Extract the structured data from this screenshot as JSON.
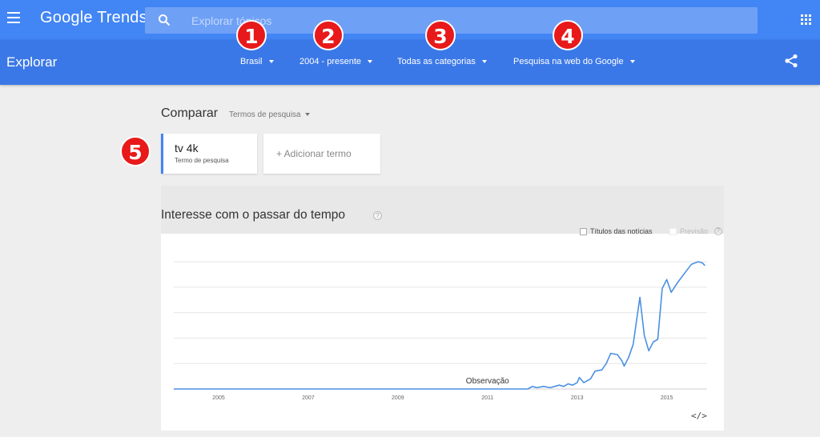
{
  "app": {
    "logo_text": "Google Trends"
  },
  "search": {
    "placeholder": "Explorar tópicos"
  },
  "header": {
    "page_title": "Explorar"
  },
  "filters": [
    {
      "label": "Brasil"
    },
    {
      "label": "2004 - presente"
    },
    {
      "label": "Todas as categorias"
    },
    {
      "label": "Pesquisa na web do Google"
    }
  ],
  "badges": [
    "1",
    "2",
    "3",
    "4",
    "5"
  ],
  "compare": {
    "title": "Comparar",
    "type_label": "Termos de pesquisa",
    "term": {
      "name": "tv 4k",
      "sub": "Termo de pesquisa"
    },
    "add_label": "+ Adicionar termo"
  },
  "interest": {
    "title": "Interesse com o passar do tempo",
    "help": "?",
    "legend_news": "Títulos das notícias",
    "legend_forecast": "Previsão",
    "legend_help": "?",
    "embed": "</>"
  },
  "chart_data": {
    "type": "line",
    "series": [
      {
        "values": [
          [
            2004.0,
            0
          ],
          [
            2005.0,
            0
          ],
          [
            2006.0,
            0
          ],
          [
            2007.0,
            0
          ],
          [
            2008.0,
            0
          ],
          [
            2009.0,
            0
          ],
          [
            2010.0,
            0
          ],
          [
            2011.0,
            0
          ],
          [
            2011.9,
            0
          ],
          [
            2012.0,
            2
          ],
          [
            2012.1,
            1
          ],
          [
            2012.25,
            2
          ],
          [
            2012.4,
            1
          ],
          [
            2012.5,
            2
          ],
          [
            2012.6,
            3
          ],
          [
            2012.7,
            2
          ],
          [
            2012.8,
            4
          ],
          [
            2012.9,
            3
          ],
          [
            2013.0,
            5
          ],
          [
            2013.05,
            9
          ],
          [
            2013.15,
            5
          ],
          [
            2013.3,
            8
          ],
          [
            2013.4,
            14
          ],
          [
            2013.55,
            15
          ],
          [
            2013.65,
            20
          ],
          [
            2013.75,
            28
          ],
          [
            2013.9,
            27
          ],
          [
            2014.0,
            22
          ],
          [
            2014.05,
            18
          ],
          [
            2014.15,
            25
          ],
          [
            2014.25,
            35
          ],
          [
            2014.35,
            60
          ],
          [
            2014.4,
            72
          ],
          [
            2014.5,
            42
          ],
          [
            2014.6,
            30
          ],
          [
            2014.7,
            37
          ],
          [
            2014.8,
            39
          ],
          [
            2014.9,
            79
          ],
          [
            2015.0,
            86
          ],
          [
            2015.1,
            76
          ],
          [
            2015.25,
            84
          ],
          [
            2015.4,
            91
          ],
          [
            2015.55,
            98
          ],
          [
            2015.7,
            100
          ],
          [
            2015.8,
            99
          ],
          [
            2015.85,
            97
          ]
        ]
      }
    ],
    "x_ticks": [
      "2005",
      "2007",
      "2009",
      "2011",
      "2013",
      "2015"
    ],
    "annotation": "Observação",
    "ylim": [
      0,
      100
    ],
    "grid": true,
    "color": "#4a90e2"
  },
  "colors": {
    "topbar": "#4285f4",
    "subbar": "#3b78e7",
    "badge": "#e8191a",
    "line": "#4a90e2"
  }
}
